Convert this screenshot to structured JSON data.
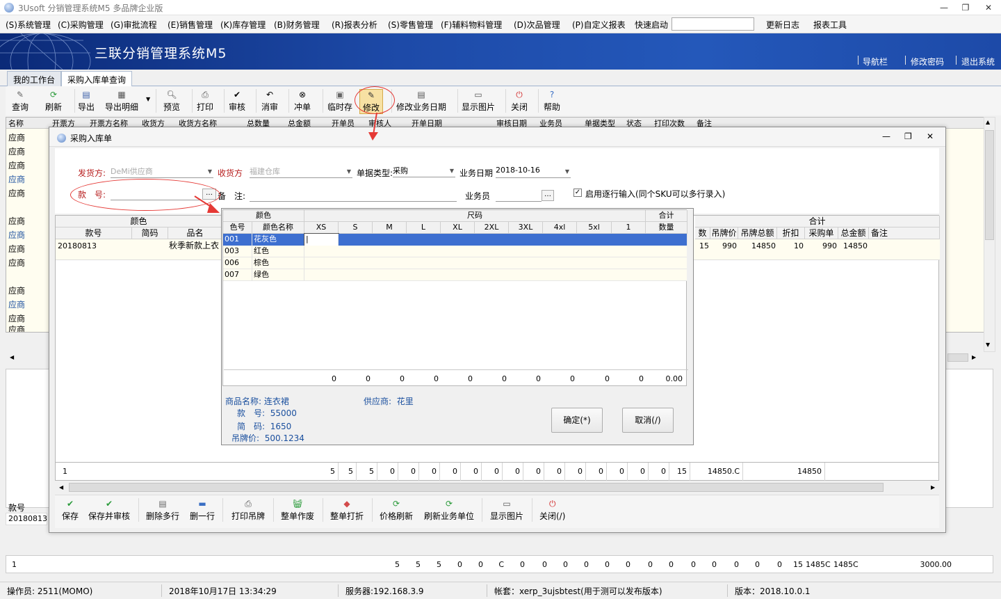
{
  "app": {
    "title": "3Usoft 分销管理系统M5 多品牌企业版",
    "banner_title": "三联分销管理系统M5",
    "header_links": [
      "导航栏",
      "修改密码",
      "退出系统"
    ]
  },
  "window_controls": [
    "—",
    "❐",
    "✕"
  ],
  "menu": {
    "items": [
      "(S)系统管理",
      "(C)采购管理",
      "(G)审批流程",
      "(E)销售管理",
      "(K)库存管理",
      "(B)财务管理",
      "(R)报表分析",
      "(S)零售管理",
      "(F)辅料物料管理",
      "(D)次品管理",
      "(P)自定义报表",
      "快速启动",
      "更新日志",
      "报表工具"
    ],
    "quick_start_value": ""
  },
  "tabs": [
    "我的工作台",
    "采购入库单查询"
  ],
  "toolbar": [
    "查询",
    "刷新",
    "导出",
    "导出明细",
    "预览",
    "打印",
    "审核",
    "消审",
    "冲单",
    "临时存",
    "修改",
    "修改业务日期",
    "显示图片",
    "关闭",
    "帮助"
  ],
  "background_grid": {
    "headers": [
      "名称",
      "开票方",
      "开票方名称",
      "收货方",
      "收货方名称",
      "总数量",
      "总金额",
      "开单员",
      "审核人",
      "开单日期",
      "审核日期",
      "业务员",
      "单据类型",
      "状态",
      "打印次数",
      "备注"
    ],
    "rows": [
      "应商",
      "应商",
      "应商",
      "应商",
      "应商",
      "",
      "应商",
      "应商",
      "应商",
      "应商",
      "",
      "应商",
      "应商",
      "应商",
      "应商"
    ],
    "lower_label": "款号",
    "lower_value": "20180813"
  },
  "bottom_summary": [
    "1",
    "5",
    "5",
    "5",
    "0",
    "0",
    "C",
    "0",
    "0",
    "0",
    "0",
    "0",
    "0",
    "0",
    "0",
    "0",
    "0",
    "0",
    "0",
    "0",
    "15",
    "1485C",
    "1485C",
    "3000.00"
  ],
  "dialog": {
    "title": "采购入库单",
    "fields": {
      "sender_label": "发货方:",
      "sender_value": "DeMi供应商",
      "receiver_label": "收货方",
      "receiver_value": "福建仓库",
      "doc_type_label": "单据类型:",
      "doc_type_value": "采购",
      "biz_date_label": "业务日期",
      "biz_date_value": "2018-10-16",
      "style_no_label": "款　号:",
      "style_no_value": "",
      "remark_label": "备　注:",
      "remark_value": "",
      "salesman_label": "业务员",
      "salesman_value": "",
      "row_input_label": "启用逐行输入(同个SKU可以多行录入)",
      "row_input_checked": true
    },
    "grid": {
      "group_color": "颜色",
      "group_total": "合计",
      "headers_left": [
        "款号",
        "简码",
        "品名"
      ],
      "headers_right": [
        "数量",
        "吊牌价",
        "吊牌总额",
        "折扣",
        "采购单价",
        "总金额",
        "备注"
      ],
      "row": {
        "style_no": "20180813",
        "short_code": "",
        "name": "秋季新款上衣",
        "qty": "15",
        "tag_price": "990",
        "tag_total": "14850",
        "discount": "10",
        "unit_price": "990",
        "amount": "14850"
      }
    },
    "summary": [
      "1",
      "5",
      "5",
      "5",
      "0",
      "0",
      "0",
      "0",
      "0",
      "0",
      "0",
      "0",
      "0",
      "0",
      "0",
      "0",
      "0",
      "0",
      "15",
      "14850.C",
      "14850"
    ],
    "toolbar": [
      "保存",
      "保存并审核",
      "删除多行",
      "删一行",
      "打印吊牌",
      "整单作废",
      "整单打折",
      "价格刷新",
      "刷新业务单位",
      "显示图片",
      "关闭(/)"
    ]
  },
  "sku_popup": {
    "header_color": "颜色",
    "header_size": "尺码",
    "header_total": "合计",
    "sub_color_code": "色号",
    "sub_color_name": "颜色名称",
    "sub_qty": "数量",
    "sizes": [
      "XS",
      "S",
      "M",
      "L",
      "XL",
      "2XL",
      "3XL",
      "4xl",
      "5xl",
      "1"
    ],
    "rows": [
      {
        "code": "001",
        "name": "花灰色",
        "selected": true
      },
      {
        "code": "003",
        "name": "红色",
        "selected": false
      },
      {
        "code": "006",
        "name": "棕色",
        "selected": false
      },
      {
        "code": "007",
        "name": "绿色",
        "selected": false
      }
    ],
    "totals": [
      "0",
      "0",
      "0",
      "0",
      "0",
      "0",
      "0",
      "0",
      "0",
      "0",
      "0.00"
    ],
    "info": {
      "product_name_label": "商品名称:",
      "product_name": "连衣裙",
      "supplier_label": "供应商:",
      "supplier": "花里",
      "style_no_label": "款　号:",
      "style_no": "55000",
      "short_code_label": "简　码:",
      "short_code": "1650",
      "tag_price_label": "吊牌价:",
      "tag_price": "500.1234"
    },
    "confirm": "确定(*)",
    "cancel": "取消(/)"
  },
  "status_bar": {
    "operator": "操作员: 2511(MOMO)",
    "datetime": "2018年10月17日 13:34:29",
    "server": "服务器:192.168.3.9",
    "account": "帐套：xerp_3ujsbtest(用于测可以发布版本)",
    "version": "版本：2018.10.0.1"
  },
  "colors": {
    "banner": "#1d4aa8",
    "selection": "#3d6fd0",
    "annotation": "#e53935"
  }
}
